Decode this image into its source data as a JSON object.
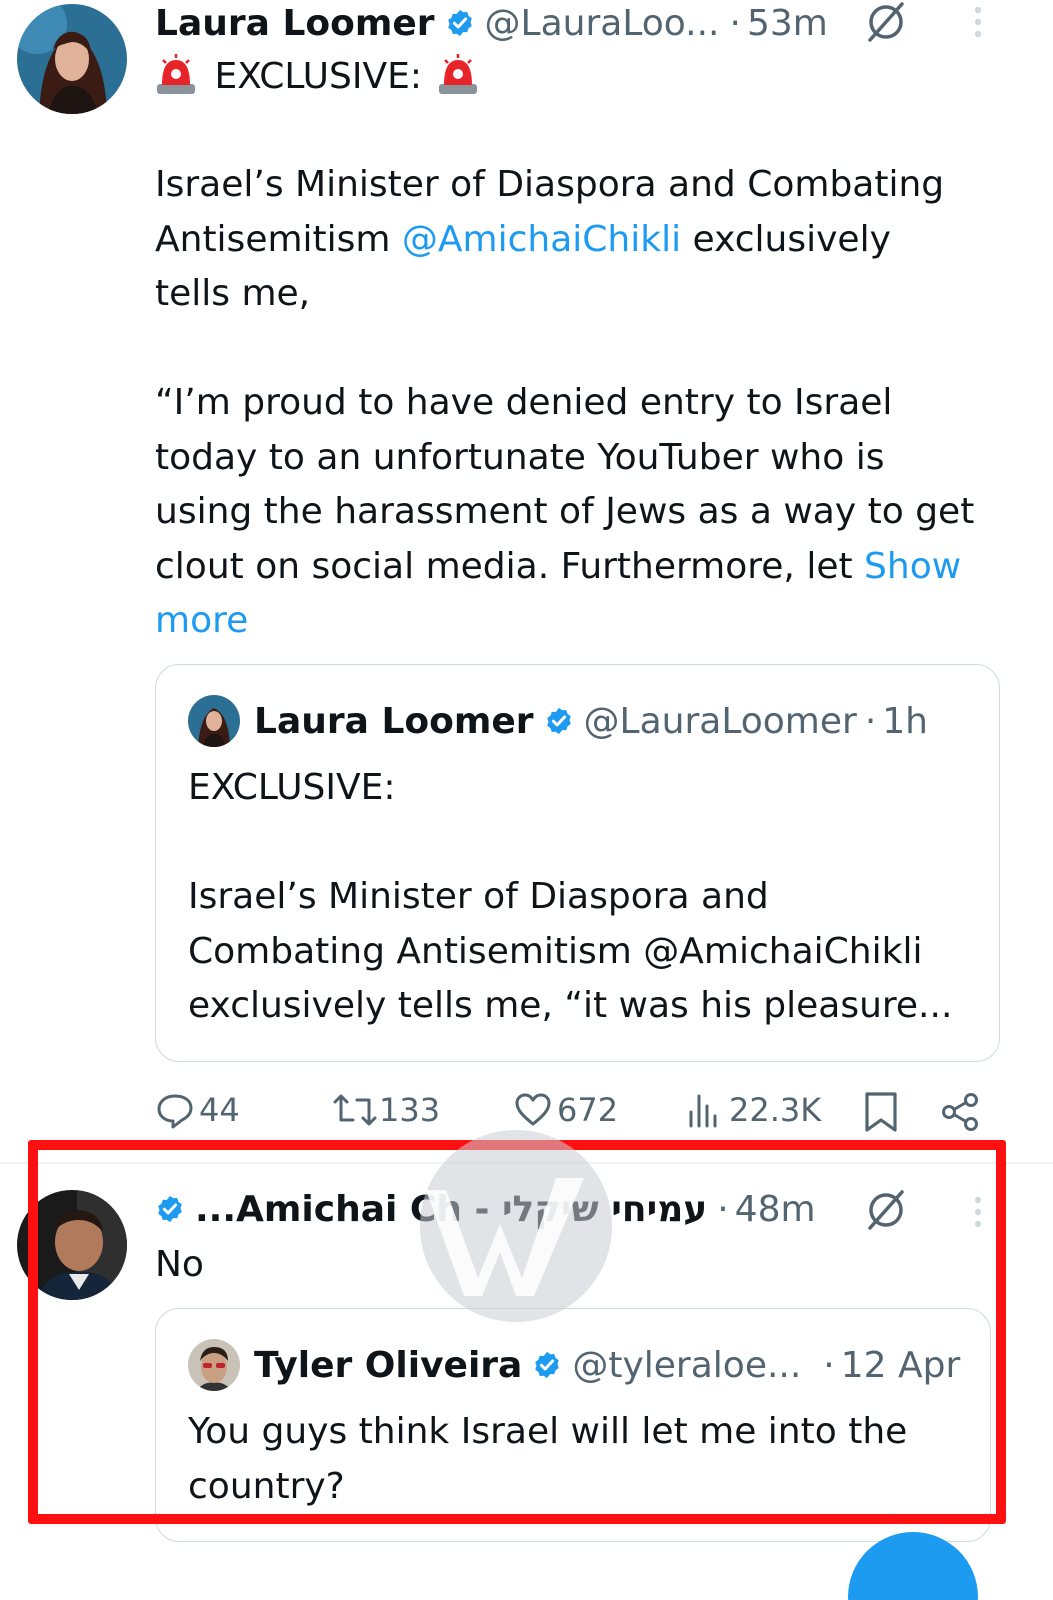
{
  "tweet": {
    "author_name": "Laura Loomer",
    "author_handle": "@LauraLoo...",
    "time": "53m",
    "headline": "EXCLUSIVE:",
    "body_line1": "Israel’s Minister of Diaspora and Combating",
    "body_line2_pre": "Antisemitism ",
    "body_mention": "@AmichaiChikli",
    "body_line2_post": " exclusively",
    "body_line3": "tells me,",
    "quote_line1": "“I’m proud to have denied entry to Israel",
    "quote_line2": "today to an unfortunate YouTuber who is",
    "quote_line3": "using the harassment of Jews as a way to get",
    "quote_line4_pre": "clout on social media. Furthermore, let ",
    "show_more_1": "Show",
    "show_more_2": "more"
  },
  "quoted_tweet": {
    "author_name": "Laura Loomer",
    "author_handle": "@LauraLoomer",
    "time": "1h",
    "line1": "EXCLUSIVE:",
    "line2": "Israel’s Minister of Diaspora and",
    "line3": "Combating Antisemitism @AmichaiChikli",
    "line4": "exclusively tells me, “it was his pleasure..."
  },
  "actions": {
    "replies": "44",
    "reposts": "133",
    "likes": "672",
    "views": "22.3K"
  },
  "reply": {
    "author_name": "...Amichai Ch - עמיחי שיקלי",
    "time": "48m",
    "text": "No"
  },
  "reply_quoted": {
    "author_name": "Tyler Oliveira",
    "author_handle": "@tyleraloe...",
    "time": "12 Apr",
    "line1": "You guys think Israel will let me into the",
    "line2": "country?"
  },
  "colors": {
    "link": "#1d9bf0",
    "highlight_frame": "#ff1010",
    "verified": "#1d9bf0"
  }
}
